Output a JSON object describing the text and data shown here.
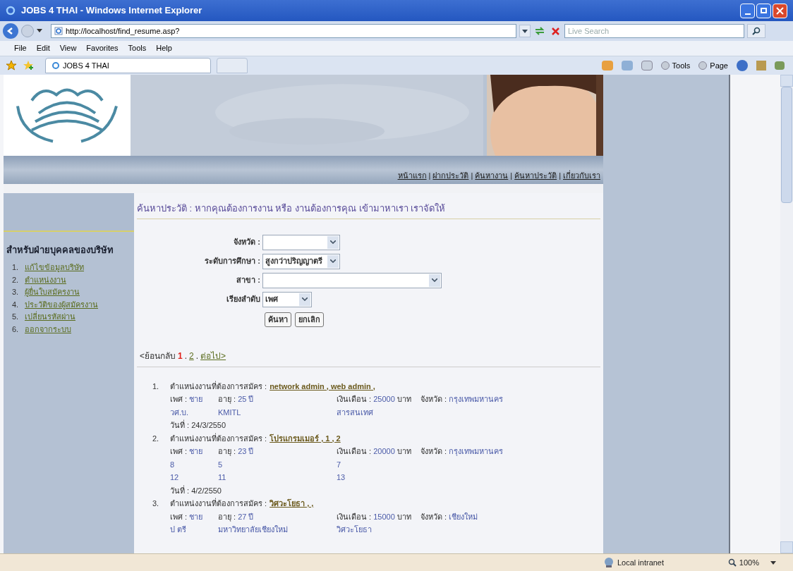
{
  "window": {
    "title": "JOBS 4 THAI - Windows Internet Explorer"
  },
  "address_bar": {
    "url": "http://localhost/find_resume.asp?"
  },
  "search": {
    "placeholder": "Live Search"
  },
  "menu": [
    "File",
    "Edit",
    "View",
    "Favorites",
    "Tools",
    "Help"
  ],
  "tabs": [
    {
      "label": "JOBS 4 THAI",
      "selected": true
    }
  ],
  "command_bar": [
    "Tools",
    "Page"
  ],
  "nav": {
    "separator": "|",
    "links": [
      "หน้าแรก",
      "ฝากประวัติ",
      "ค้นหางาน",
      "ค้นหาประวัติ",
      "เกี่ยวกับเรา"
    ]
  },
  "sidebar": {
    "heading": "สำหรับฝ่ายบุคคลของบริษัท",
    "items": [
      {
        "number": "1.",
        "label": "แก้ไขข้อมูลบริษัท"
      },
      {
        "number": "2.",
        "label": "ตำแหน่งงาน"
      },
      {
        "number": "3.",
        "label": "ผู้ยื่นใบสมัครงาน"
      },
      {
        "number": "4.",
        "label": "ประวัติของผู้สมัครงาน"
      },
      {
        "number": "5.",
        "label": "เปลี่ยนรหัสผ่าน"
      },
      {
        "number": "6.",
        "label": "ออกจากระบบ"
      }
    ]
  },
  "heading": "ค้นหาประวัติ : หากคุณต้องการงาน หรือ งานต้องการคุณ เข้ามาหาเรา เราจัดให้",
  "form": {
    "fields": [
      {
        "label": "จังหวัด :"
      },
      {
        "label": "ระดับการศึกษา :",
        "value": "สูงกว่าปริญญาตรี"
      },
      {
        "label": "สาขา :"
      },
      {
        "label": "เรียงลำดับ",
        "value": "เพศ"
      }
    ],
    "buttons": [
      "ค้นหา",
      "ยกเลิก"
    ]
  },
  "pagination": [
    {
      "kind": "text",
      "label": "<ย้อนกลับ"
    },
    {
      "kind": "page",
      "label": "1",
      "selected": true
    },
    {
      "kind": "sep",
      "label": "."
    },
    {
      "kind": "page",
      "label": "2",
      "selected": false
    },
    {
      "kind": "sep",
      "label": "."
    },
    {
      "kind": "link",
      "label": "ต่อไป>"
    }
  ],
  "results": [
    {
      "number": "1.",
      "position_label": "ตำแหน่งงานที่ต้องการสมัคร :",
      "position": "network admin , web admin ,",
      "details": [
        {
          "label": "เพศ :",
          "value": "ชาย"
        },
        {
          "label": "อายุ :",
          "value": "25 ปี"
        },
        {
          "label": "เงินเดือน :",
          "value": "25000",
          "unit": "บาท"
        },
        {
          "label": "จังหวัด :",
          "value": "กรุงเทพมหานคร"
        }
      ],
      "extra_rows": [
        [
          "วศ.บ.",
          "KMITL",
          "สารสนเทศ"
        ]
      ],
      "date_label": "วันที่ :",
      "date": "24/3/2550"
    },
    {
      "number": "2.",
      "position_label": "ตำแหน่งงานที่ต้องการสมัคร :",
      "position": "โปรแกรมเมอร์ , 1 , 2",
      "details": [
        {
          "label": "เพศ :",
          "value": "ชาย"
        },
        {
          "label": "อายุ :",
          "value": "23 ปี"
        },
        {
          "label": "เงินเดือน :",
          "value": "20000",
          "unit": "บาท"
        },
        {
          "label": "จังหวัด :",
          "value": "กรุงเทพมหานคร"
        }
      ],
      "extra_rows": [
        [
          "8",
          "5",
          "7"
        ],
        [
          "12",
          "11",
          "13"
        ]
      ],
      "date_label": "วันที่ :",
      "date": "4/2/2550"
    },
    {
      "number": "3.",
      "position_label": "ตำแหน่งงานที่ต้องการสมัคร :",
      "position": "วิศวะโยธา , ,",
      "details": [
        {
          "label": "เพศ :",
          "value": "ชาย"
        },
        {
          "label": "อายุ :",
          "value": "27 ปี"
        },
        {
          "label": "เงินเดือน :",
          "value": "15000",
          "unit": "บาท"
        },
        {
          "label": "จังหวัด :",
          "value": "เชียงใหม่"
        }
      ],
      "extra_rows": [
        [
          "ป ตรี",
          "มหาวิทยาลัยเชียงใหม่",
          "วิศวะโยธา"
        ]
      ]
    }
  ],
  "status_bar": {
    "zone": "Local intranet",
    "zoom": "100%"
  }
}
